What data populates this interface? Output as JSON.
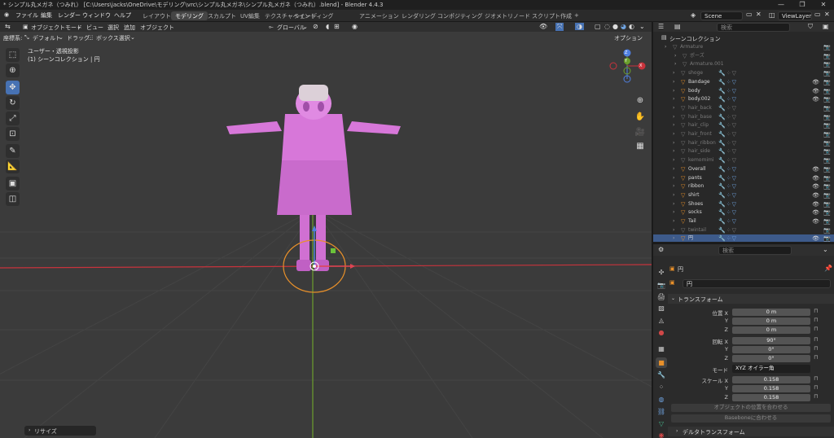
{
  "titlebar": {
    "title": "* シンプル丸メガネ（つみれ） [C:\\Users\\jacks\\OneDrive\\モデリング\\vrc\\シンプル丸メガネ\\シンプル丸メガネ（つみれ）.blend] - Blender 4.4.3"
  },
  "menu": [
    "ファイル",
    "編集",
    "レンダー",
    "ウィンドウ",
    "ヘルプ"
  ],
  "workspaces": [
    "レイアウト",
    "モデリング",
    "スカルプト",
    "UV編集",
    "テクスチャペイント",
    "シェーディング",
    "アニメーション",
    "レンダリング",
    "コンポジティング",
    "ジオメトリノード",
    "スクリプト作成"
  ],
  "active_workspace": "モデリング",
  "scene": "Scene",
  "view_layer": "ViewLayer",
  "viewport_header": {
    "mode": "オブジェクトモード",
    "menus": [
      "ビュー",
      "選択",
      "追加",
      "オブジェクト"
    ],
    "transform_space": "グローバル",
    "options": "オプション"
  },
  "toolbar_header": {
    "coord_label": "座標系:",
    "coord_value": "デフォルト",
    "drag_label": "ドラッグ:",
    "drag_value": "ボックス選択"
  },
  "viewport": {
    "overlay_line1": "ユーザー・透視投影",
    "overlay_line2": "(1) シーンコレクション | 円",
    "gizmo_x": "X",
    "gizmo_y": "Y",
    "gizmo_z": "Z"
  },
  "last_op": "リサイズ",
  "outliner": {
    "search_placeholder": "検索",
    "collection": "シーンコレクション",
    "rows": [
      {
        "name": "Armature",
        "dim": true,
        "indent": 0
      },
      {
        "name": "ポーズ",
        "dim": true,
        "indent": 1
      },
      {
        "name": "Armature.001",
        "dim": true,
        "indent": 1
      },
      {
        "name": "shoge",
        "dim": true
      },
      {
        "name": "Bandage",
        "dim": false
      },
      {
        "name": "body",
        "dim": false
      },
      {
        "name": "body.002",
        "dim": false
      },
      {
        "name": "hair_back",
        "dim": true
      },
      {
        "name": "hair_base",
        "dim": true
      },
      {
        "name": "hair_clip",
        "dim": true
      },
      {
        "name": "hair_front",
        "dim": true
      },
      {
        "name": "hair_ribbon",
        "dim": true
      },
      {
        "name": "hair_side",
        "dim": true
      },
      {
        "name": "kemomimi",
        "dim": true
      },
      {
        "name": "Overall",
        "dim": false
      },
      {
        "name": "pants",
        "dim": false
      },
      {
        "name": "ribbon",
        "dim": false
      },
      {
        "name": "shirt",
        "dim": false
      },
      {
        "name": "Shoes",
        "dim": false
      },
      {
        "name": "socks",
        "dim": false
      },
      {
        "name": "Tail",
        "dim": false
      },
      {
        "name": "twintail",
        "dim": true
      },
      {
        "name": "円",
        "dim": false,
        "selected": true
      }
    ]
  },
  "properties": {
    "search_placeholder": "検索",
    "object_name": "円",
    "object_field": "円",
    "transform_header": "トランスフォーム",
    "location_label": "位置 X",
    "location": [
      "0 m",
      "0 m",
      "0 m"
    ],
    "rotation_label": "回転 X",
    "rotation": [
      "90°",
      "0°",
      "0°"
    ],
    "axis_y": "Y",
    "axis_z": "Z",
    "mode_label": "モード",
    "mode_value": "XYZ オイラー角",
    "scale_label": "スケール X",
    "scale": [
      "0.158",
      "0.158",
      "0.158"
    ],
    "btn_origin": "オブジェクトの位置を合わせる",
    "btn_bone": "Baseboneに合わせる",
    "delta_header": "デルタトランスフォーム"
  },
  "colors": {
    "accent": "#4772b3",
    "object_orange": "#e8902a",
    "character_pink": "#d777d9",
    "x_axis": "#c8333c",
    "y_axis": "#6b9f2c"
  }
}
